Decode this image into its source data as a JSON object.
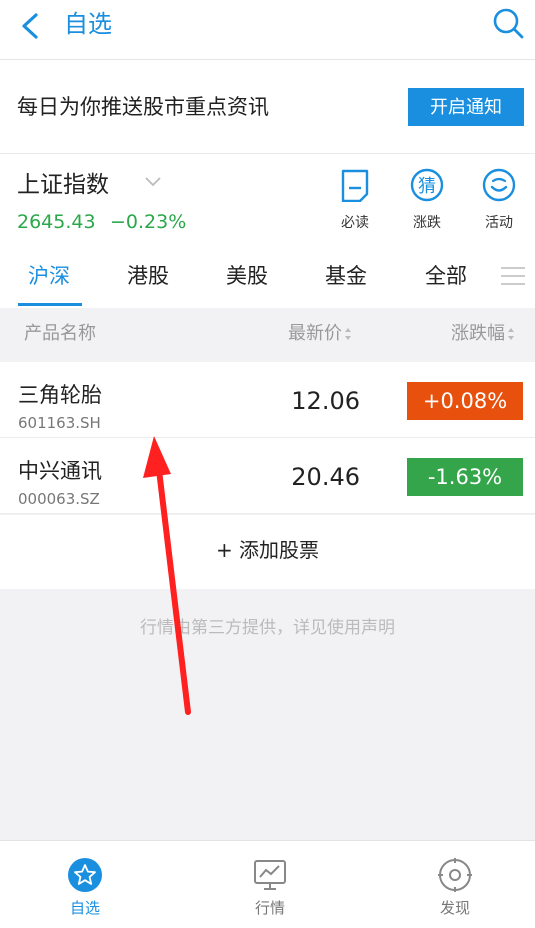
{
  "header": {
    "title": "自选",
    "back_icon": "chevron-left-icon",
    "search_icon": "search-icon"
  },
  "banner": {
    "text": "每日为你推送股市重点资讯",
    "button_label": "开启通知"
  },
  "index": {
    "name": "上证指数",
    "value": "2645.43",
    "change": "−0.23%",
    "shortcuts": [
      {
        "label": "必读",
        "icon": "document-icon"
      },
      {
        "label": "涨跌",
        "icon": "guess-icon",
        "glyph": "猜"
      },
      {
        "label": "活动",
        "icon": "smile-icon"
      }
    ]
  },
  "tabs": [
    {
      "label": "沪深",
      "active": true
    },
    {
      "label": "港股"
    },
    {
      "label": "美股"
    },
    {
      "label": "基金"
    },
    {
      "label": "全部"
    }
  ],
  "columns": {
    "name": "产品名称",
    "price": "最新价",
    "change": "涨跌幅"
  },
  "stocks": [
    {
      "name": "三角轮胎",
      "code": "601163.SH",
      "price": "12.06",
      "change": "+0.08%",
      "change_color": "#e8500d"
    },
    {
      "name": "中兴通讯",
      "code": "000063.SZ",
      "price": "20.46",
      "change": "-1.63%",
      "change_color": "#34a54a"
    }
  ],
  "add_label": "+ 添加股票",
  "disclaimer": "行情由第三方提供，详见使用声明",
  "bottom_nav": [
    {
      "label": "自选",
      "icon": "star-icon",
      "active": true
    },
    {
      "label": "行情",
      "icon": "chart-icon"
    },
    {
      "label": "发现",
      "icon": "target-icon"
    }
  ],
  "colors": {
    "accent": "#1a8fe0",
    "down_green": "#2aa84a",
    "annotation_arrow": "#ff2020"
  }
}
